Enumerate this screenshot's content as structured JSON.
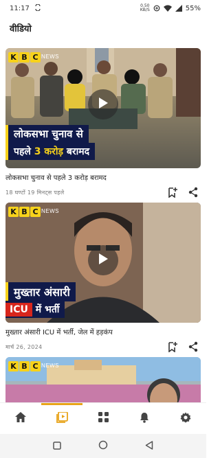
{
  "status_bar": {
    "time": "11:17",
    "left_icon": "sync-icon",
    "net_speed_value": "0.50",
    "net_speed_unit": "KB/S",
    "battery_percent": "55%"
  },
  "header": {
    "title": "वीडियो"
  },
  "videos": [
    {
      "logo_letters": [
        "K",
        "B",
        "C"
      ],
      "logo_suffix": "NEWS",
      "headline_line1": "लोकसभा चुनाव से",
      "headline_line2_a": "पहले",
      "headline_line2_b": "3 करोड़",
      "headline_line2_c": "बरामद",
      "title": "लोकसभा चुनाव से पहले 3 करोड़ बरामद",
      "time": "18 घण्टों  19 मिनट्स  पहले"
    },
    {
      "logo_letters": [
        "K",
        "B",
        "C"
      ],
      "logo_suffix": "NEWS",
      "headline_line1": "मुख्तार अंसारी",
      "headline_line2_a": "ICU",
      "headline_line2_b": "में भर्ती",
      "title": "मुख्तार अंसारी ICU में भर्ती, जेल में हड़कंप",
      "time": "मार्च 26, 2024"
    },
    {
      "logo_letters": [
        "K",
        "B",
        "C"
      ],
      "logo_suffix": "NEWS"
    }
  ],
  "bottom_nav": {
    "items": [
      "home-icon",
      "video-icon",
      "grid-icon",
      "bell-icon",
      "settings-icon"
    ],
    "active_index": 1,
    "accent_color": "#e8a318"
  }
}
